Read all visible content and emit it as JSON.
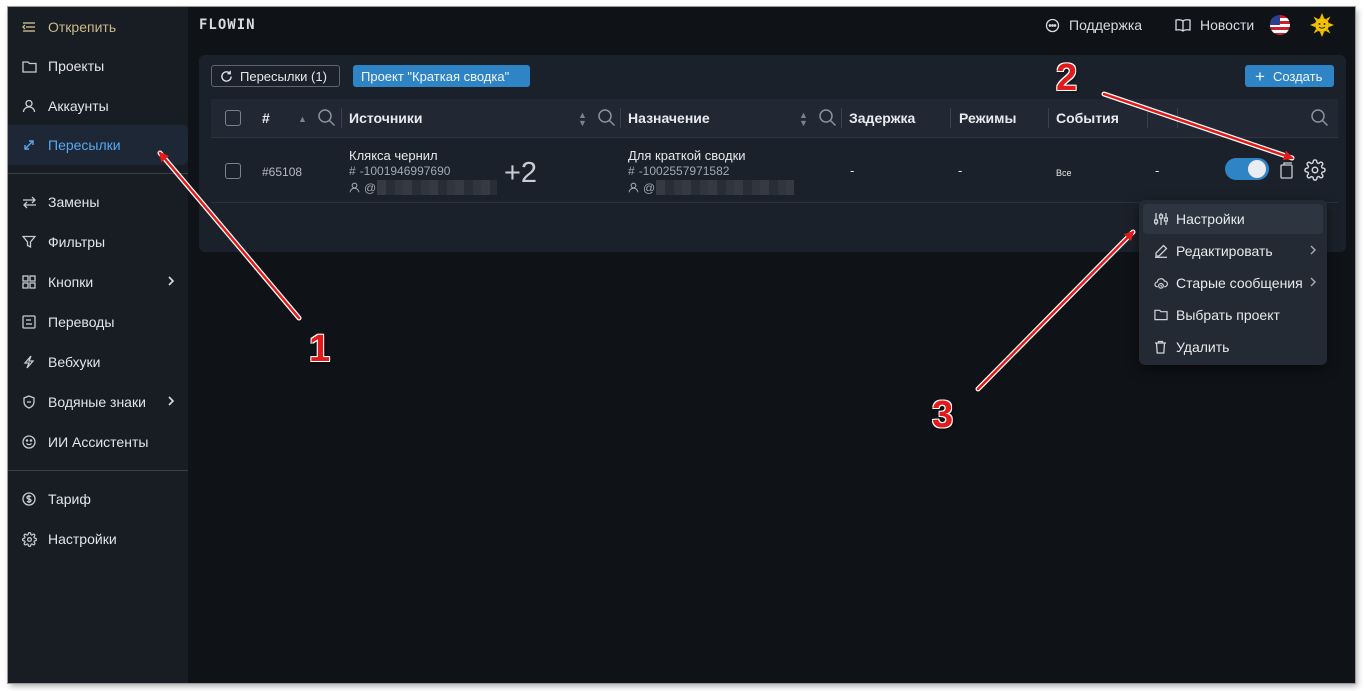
{
  "sidebar": {
    "unpin_label": "Открепить",
    "items": [
      {
        "label": "Проекты",
        "icon": "folder-icon"
      },
      {
        "label": "Аккаунты",
        "icon": "user-icon"
      },
      {
        "label": "Пересылки",
        "icon": "forward-icon",
        "active": true
      },
      {
        "label": "Замены",
        "icon": "swap-icon"
      },
      {
        "label": "Фильтры",
        "icon": "filter-icon"
      },
      {
        "label": "Кнопки",
        "icon": "buttons-icon",
        "has_submenu": true
      },
      {
        "label": "Переводы",
        "icon": "translate-icon"
      },
      {
        "label": "Вебхуки",
        "icon": "webhook-icon"
      },
      {
        "label": "Водяные знаки",
        "icon": "watermark-icon",
        "has_submenu": true
      },
      {
        "label": "ИИ Ассистенты",
        "icon": "ai-icon"
      },
      {
        "label": "Тариф",
        "icon": "dollar-icon"
      },
      {
        "label": "Настройки",
        "icon": "gear-icon"
      }
    ]
  },
  "header": {
    "brand": "FLOWIN",
    "support_label": "Поддержка",
    "news_label": "Новости",
    "language_flag": "us-flag-icon",
    "avatar_icon": "sun-avatar-icon"
  },
  "toolbar": {
    "refresh_label": "Пересылки (1)",
    "project_chip": "Проект \"Краткая сводка\"",
    "create_label": "Создать",
    "create_plus": "+"
  },
  "table": {
    "columns": [
      "#",
      "Источники",
      "Назначение",
      "Задержка",
      "Режимы",
      "События"
    ],
    "rows": [
      {
        "id": "#65108",
        "source_name": "Клякса чернил",
        "source_chat_id": "-1001946997690",
        "source_user_prefix": "@",
        "extra_sources": "+2",
        "dest_name": "Для краткой сводки",
        "dest_chat_id": "-1002557971582",
        "dest_user_prefix": "@",
        "delay": "-",
        "modes": "-",
        "events": "Все",
        "extra": "-",
        "enabled": true
      }
    ]
  },
  "menu": {
    "items": [
      {
        "label": "Настройки",
        "icon": "sliders-icon",
        "highlighted": true
      },
      {
        "label": "Редактировать",
        "icon": "pencil-icon",
        "has_submenu": true
      },
      {
        "label": "Старые сообщения",
        "icon": "cloud-history-icon",
        "has_submenu": true
      },
      {
        "label": "Выбрать проект",
        "icon": "folder-icon"
      },
      {
        "label": "Удалить",
        "icon": "trash-icon"
      }
    ]
  },
  "annotations": {
    "n1": "1",
    "n2": "2",
    "n3": "3",
    "color": "#e21a1a"
  },
  "colors": {
    "accent": "#2f84c6",
    "active_link": "#58a7f0",
    "background": "#0f1217",
    "sidebar": "#181c23",
    "panel": "#1b212a"
  }
}
